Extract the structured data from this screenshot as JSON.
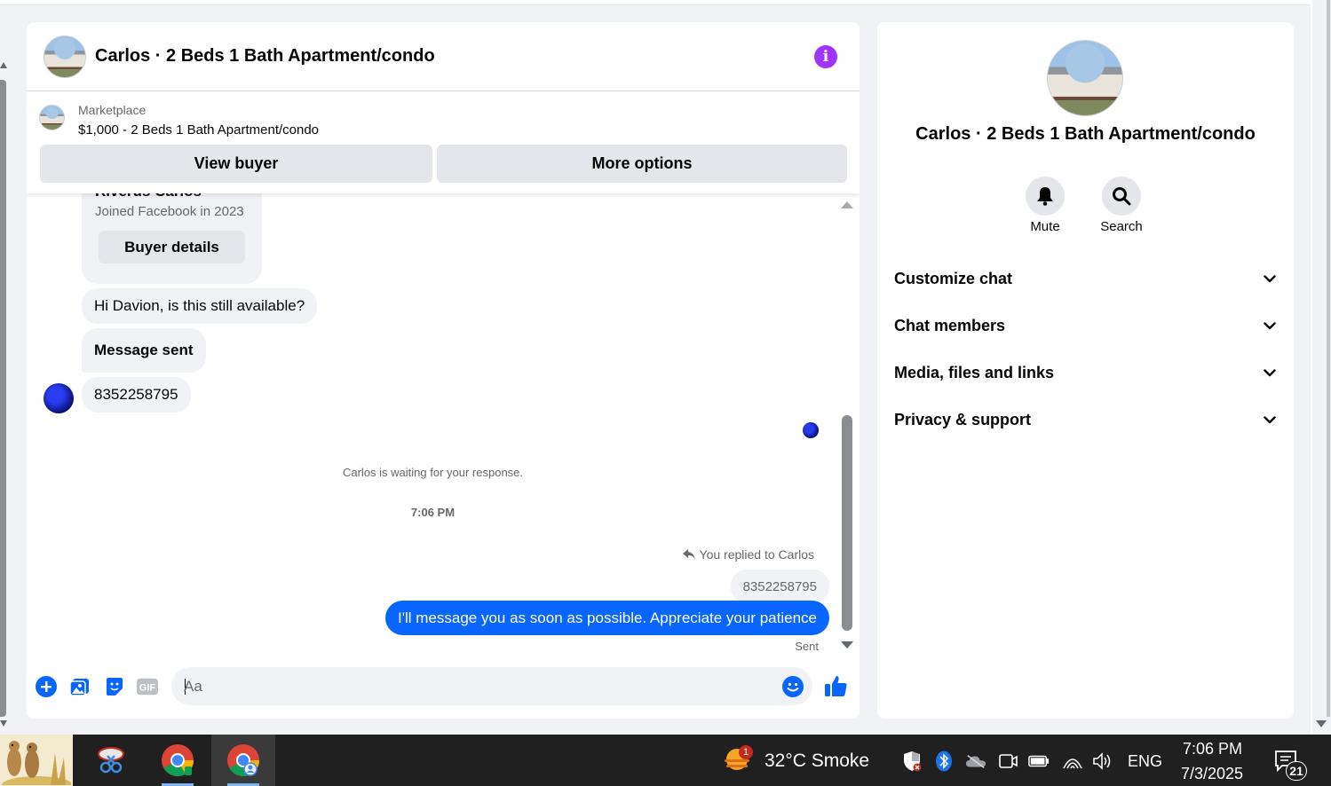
{
  "chat": {
    "header_title": "Carlos · 2 Beds 1 Bath Apartment/condo",
    "info_icon": "info-icon"
  },
  "listing": {
    "label": "Marketplace",
    "price_title": "$1,000 - 2 Beds 1 Bath Apartment/condo",
    "view_buyer": "View buyer",
    "more_options": "More options"
  },
  "profile_card": {
    "name": "Riverus Carlos",
    "joined": "Joined Facebook in 2023",
    "details_button": "Buyer details"
  },
  "messages": {
    "incoming": [
      "Hi Davion, is this still available?",
      "Message sent",
      "8352258795"
    ],
    "waiting": "Carlos is waiting for your response.",
    "timestamp": "7:06 PM",
    "replied_to": "You replied to Carlos",
    "quoted": "8352258795",
    "outgoing": "I'll message you as soon as possible. Appreciate your patience",
    "status": "Sent"
  },
  "composer": {
    "placeholder": "Aa",
    "gif_label": "GIF"
  },
  "info_panel": {
    "title": "Carlos · 2 Beds 1 Bath Apartment/condo",
    "actions": [
      {
        "label": "Mute",
        "icon": "bell-icon"
      },
      {
        "label": "Search",
        "icon": "search-icon"
      }
    ],
    "sections": [
      "Customize chat",
      "Chat members",
      "Media, files and links",
      "Privacy & support"
    ]
  },
  "taskbar": {
    "weather_badge": "1",
    "weather": "32°C  Smoke",
    "language": "ENG",
    "time": "7:06 PM",
    "date": "7/3/2025",
    "notifications": "21"
  },
  "colors": {
    "messenger_blue": "#0866ff",
    "info_purple": "#a033ff",
    "page_bg": "#f0f2f5"
  }
}
